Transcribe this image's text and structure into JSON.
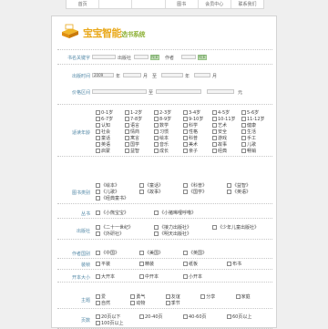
{
  "topnav": [
    "首页",
    "",
    "",
    "图书",
    "会员中心",
    "联系我们"
  ],
  "brand": {
    "title": "宝宝智能",
    "subtitle": "选书系统"
  },
  "search": {
    "label": "书名关键字",
    "label2": "出版社",
    "label3": "作者",
    "btn": "搜索"
  },
  "date": {
    "label": "出版时间",
    "year": "2009",
    "y_unit": "年",
    "m_unit": "月",
    "to": "至"
  },
  "price": {
    "label": "价格区间",
    "unit": "元",
    "to": "至"
  },
  "sections": [
    {
      "label": "适读年龄",
      "cols": 6,
      "items": [
        "0-1岁",
        "1-2岁",
        "2-3岁",
        "3-4岁",
        "4-5岁",
        "5-6岁",
        "6-7岁",
        "7-8岁",
        "8-9岁",
        "9-10岁",
        "10-11岁",
        "11-12岁",
        "认知",
        "语言",
        "数学",
        "科学",
        "艺术",
        "健康",
        "社会",
        "情商",
        "习惯",
        "性格",
        "安全",
        "生活",
        "童话",
        "寓言",
        "绘本",
        "科普",
        "游戏",
        "手工",
        "英语",
        "国学",
        "音乐",
        "美术",
        "故事",
        "儿歌",
        "启蒙",
        "益智",
        "成长",
        "亲子",
        "经典",
        "畅销"
      ]
    },
    {
      "label": "图书类别",
      "cols": 4,
      "items": [
        "《绘本》",
        "《童话》",
        "《科普》",
        "《益智》",
        "《儿歌》",
        "《故事》",
        "《国学》",
        "《英语》",
        "《经典童书》"
      ]
    },
    {
      "label": "丛书",
      "cols": 3,
      "items": [
        "《小熊宝宝》",
        "《小猪唏哩呼噜》"
      ]
    },
    {
      "label": "出版社",
      "cols": 3,
      "items": [
        "《二十一世纪》",
        "《接力出版社》",
        "《少年儿童出版社》",
        "《外研社》",
        "《明天出版社》"
      ]
    },
    {
      "label": "作者国别",
      "cols": 4,
      "items": [
        "《中国》",
        "《美国》",
        "《英国》"
      ]
    },
    {
      "label": "装帧",
      "cols": 4,
      "items": [
        "平装",
        "精装",
        "纸板",
        "布书"
      ]
    },
    {
      "label": "开本大小",
      "cols": 4,
      "items": [
        "大开本",
        "中开本",
        "小开本"
      ]
    },
    {
      "label": "主题",
      "cols": 5,
      "items": [
        "爱",
        "勇气",
        "友谊",
        "分享",
        "家庭",
        "自然",
        "动物",
        "季节"
      ]
    },
    {
      "label": "页数",
      "cols": 4,
      "items": [
        "20页以下",
        "20-40页",
        "40-60页",
        "60页以上",
        "100页以上"
      ]
    }
  ]
}
